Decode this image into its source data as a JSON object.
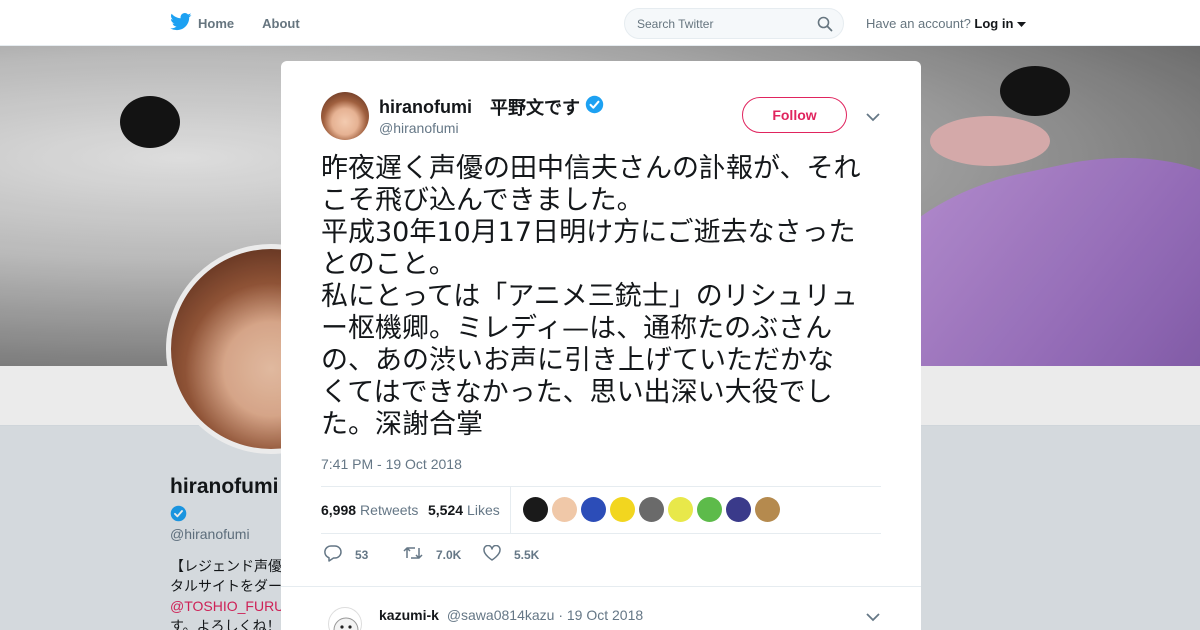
{
  "nav": {
    "home_label": "Home",
    "about_label": "About",
    "search_placeholder": "Search Twitter",
    "account_prompt": "Have an account?",
    "login_label": "Log in"
  },
  "background_profile": {
    "name": "hiranofumi",
    "handle": "@hiranofumi",
    "bio_lines": [
      "【レジェンド声優",
      "タルサイトをダー",
      "@TOSHIO_FURU",
      "す。よろしくね！"
    ]
  },
  "tweet": {
    "author_name": "hiranofumi",
    "author_name_jp": "平野文です",
    "handle": "@hiranofumi",
    "follow_label": "Follow",
    "text_lines": [
      "昨夜遅く声優の田中信夫さんの訃報が、それ",
      "こそ飛び込んできました。",
      "平成30年10月17日明け方にご逝去なさった",
      "とのこと。",
      "私にとっては「アニメ三銃士」のリシュリュ",
      "ー枢機卿。ミレディ—は、通称たのぶさん",
      "の、あの渋いお声に引き上げていただかな",
      "くてはできなかった、思い出深い大役でし",
      "た。深謝合掌"
    ],
    "timestamp": "7:41 PM - 19 Oct 2018",
    "retweets_count": "6,998",
    "retweets_label": "Retweets",
    "likes_count": "5,524",
    "likes_label": "Likes",
    "reply_count": "53",
    "retweet_action_count": "7.0K",
    "like_action_count": "5.5K"
  },
  "reply": {
    "name": "kazumi-k",
    "handle": "@sawa0814kazu",
    "separator": "·",
    "date": "19 Oct 2018"
  },
  "colors": {
    "twitter_blue": "#1da1f2",
    "follow_red": "#e0245e",
    "muted_text": "#657786"
  },
  "liker_avatar_colors": [
    "#1a1a1a",
    "#f0c8a8",
    "#2c4db8",
    "#f2d61f",
    "#6a6a6a",
    "#e8e84a",
    "#5dbb4a",
    "#3a3a8a",
    "#b58a4e"
  ]
}
